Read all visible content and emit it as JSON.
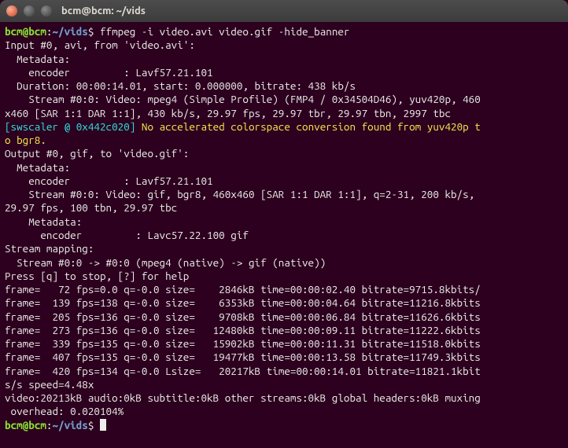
{
  "window": {
    "title": "bcm@bcm: ~/vids"
  },
  "prompt": {
    "userhost": "bcm@bcm",
    "sep": ":",
    "cwd": "~/vids",
    "dollar": "$",
    "command": "ffmpeg -i video.avi video.gif -hide_banner"
  },
  "lines": {
    "l01": "Input #0, avi, from 'video.avi':",
    "l02": "  Metadata:",
    "l03": "    encoder         : Lavf57.21.101",
    "l04": "  Duration: 00:00:14.01, start: 0.000000, bitrate: 438 kb/s",
    "l05": "    Stream #0:0: Video: mpeg4 (Simple Profile) (FMP4 / 0x34504D46), yuv420p, 460",
    "l06": "x460 [SAR 1:1 DAR 1:1], 430 kb/s, 29.97 fps, 29.97 tbr, 29.97 tbn, 2997 tbc",
    "warn_tag": "[swscaler @ 0x442c020]",
    "warn_msg1": " No accelerated colorspace conversion found from yuv420p t",
    "warn_msg2": "o bgr8.",
    "l07": "Output #0, gif, to 'video.gif':",
    "l08": "  Metadata:",
    "l09": "    encoder         : Lavf57.21.101",
    "l10": "    Stream #0:0: Video: gif, bgr8, 460x460 [SAR 1:1 DAR 1:1], q=2-31, 200 kb/s, ",
    "l11": "29.97 fps, 100 tbn, 29.97 tbc",
    "l12": "    Metadata:",
    "l13": "      encoder         : Lavc57.22.100 gif",
    "l14": "Stream mapping:",
    "l15": "  Stream #0:0 -> #0:0 (mpeg4 (native) -> gif (native))",
    "l16": "Press [q] to stop, [?] for help",
    "f1": "frame=   72 fps=0.0 q=-0.0 size=    2846kB time=00:00:02.40 bitrate=9715.8kbits/",
    "f2": "frame=  139 fps=138 q=-0.0 size=    6353kB time=00:00:04.64 bitrate=11216.8kbits",
    "f3": "frame=  205 fps=136 q=-0.0 size=    9708kB time=00:00:06.84 bitrate=11626.6kbits",
    "f4": "frame=  273 fps=136 q=-0.0 size=   12480kB time=00:00:09.11 bitrate=11222.6kbits",
    "f5": "frame=  339 fps=135 q=-0.0 size=   15902kB time=00:00:11.31 bitrate=11518.0kbits",
    "f6": "frame=  407 fps=135 q=-0.0 size=   19477kB time=00:00:13.58 bitrate=11749.3kbits",
    "f7": "frame=  420 fps=134 q=-0.0 Lsize=   20217kB time=00:00:14.01 bitrate=11821.1kbit",
    "f8": "s/s speed=4.48x",
    "v1": "video:20213kB audio:0kB subtitle:0kB other streams:0kB global headers:0kB muxing",
    "v2": " overhead: 0.020104%"
  }
}
